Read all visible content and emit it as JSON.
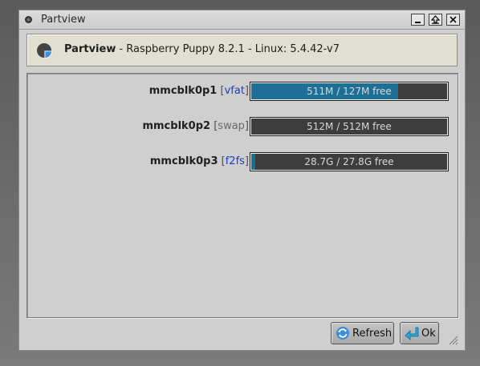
{
  "window": {
    "title": "Partview",
    "minimize_icon": "minimize-icon",
    "maximize_icon": "maximize-icon",
    "close_icon": "close-icon"
  },
  "header": {
    "icon": "pie-chart-icon",
    "app_name": "Partview",
    "info": " - Raspberry Puppy 8.2.1 - Linux: 5.4.42-v7"
  },
  "partitions": [
    {
      "device": "mmcblk0p1",
      "fs": "vfat",
      "fs_color": "#1a3ccc",
      "usage_text": "511M / 127M free",
      "used_fraction": 0.75
    },
    {
      "device": "mmcblk0p2",
      "fs": "swap",
      "fs_color": "#6a6a6a",
      "usage_text": "512M / 512M free",
      "used_fraction": 0.0
    },
    {
      "device": "mmcblk0p3",
      "fs": "f2fs",
      "fs_color": "#1a3ccc",
      "usage_text": "28.7G / 27.8G free",
      "used_fraction": 0.02
    }
  ],
  "buttons": {
    "refresh_label": "Refresh",
    "refresh_icon": "refresh-icon",
    "ok_label": "Ok",
    "ok_icon": "enter-arrow-icon"
  },
  "colors": {
    "bar_fill": "#1d6f95",
    "bar_bg": "#3d3d3d",
    "header_bg": "#e0dfd0"
  }
}
